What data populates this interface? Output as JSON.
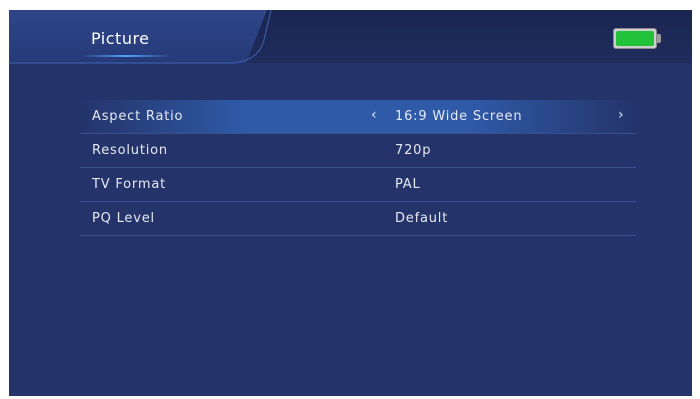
{
  "header": {
    "title": "Picture"
  },
  "battery": {
    "icon": "battery-icon",
    "level_fraction": 1.0,
    "color": "#22c23a"
  },
  "menu": {
    "items": [
      {
        "label": "Aspect Ratio",
        "value": "16:9 Wide Screen",
        "selected": true,
        "left_arrow": "‹",
        "right_arrow": "›"
      },
      {
        "label": "Resolution",
        "value": "720p"
      },
      {
        "label": "TV Format",
        "value": "PAL"
      },
      {
        "label": "PQ Level",
        "value": "Default"
      }
    ]
  },
  "colors": {
    "background": "#24346a",
    "highlight": "#2f5aa8",
    "accent": "#4fa3ff"
  }
}
